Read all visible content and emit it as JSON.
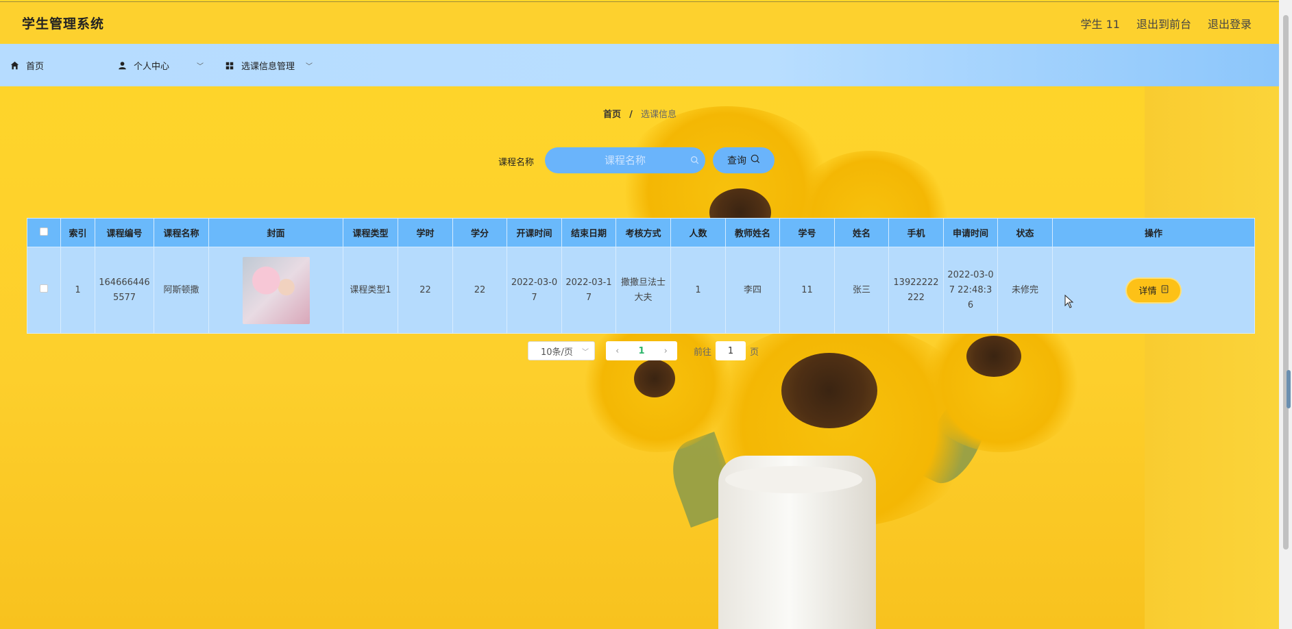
{
  "header": {
    "brand": "学生管理系统",
    "user": "学生 11",
    "back_front": "退出到前台",
    "logout": "退出登录"
  },
  "nav": {
    "home": "首页",
    "personal": "个人中心",
    "course_mgmt": "选课信息管理"
  },
  "breadcrumb": {
    "home": "首页",
    "sep": "/",
    "current": "选课信息"
  },
  "search": {
    "label": "课程名称",
    "placeholder": "课程名称",
    "button": "查询"
  },
  "table": {
    "columns": [
      "索引",
      "课程编号",
      "课程名称",
      "封面",
      "课程类型",
      "学时",
      "学分",
      "开课时间",
      "结束日期",
      "考核方式",
      "人数",
      "教师姓名",
      "学号",
      "姓名",
      "手机",
      "申请时间",
      "状态",
      "操作"
    ],
    "rows": [
      {
        "index": "1",
        "course_no": "1646664465577",
        "course_name": "阿斯顿撒",
        "course_type": "课程类型1",
        "hours": "22",
        "credits": "22",
        "start": "2022-03-07",
        "end": "2022-03-17",
        "exam": "撒撒旦法士大夫",
        "count": "1",
        "teacher": "李四",
        "student_no": "11",
        "name": "张三",
        "phone": "13922222222",
        "apply_time": "2022-03-07 22:48:36",
        "status": "未修完",
        "action": "详情"
      }
    ]
  },
  "pager": {
    "page_size": "10条/页",
    "current": "1",
    "goto_label": "前往",
    "goto_value": "1",
    "goto_suffix": "页"
  }
}
